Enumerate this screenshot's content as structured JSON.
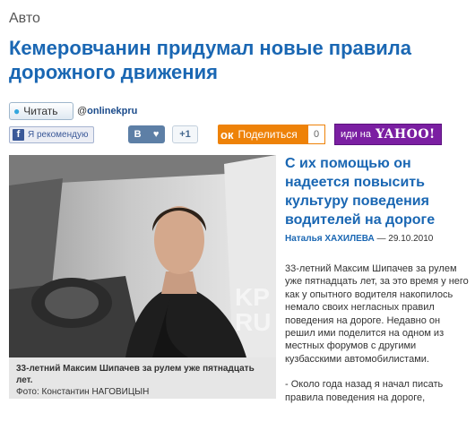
{
  "section": "Авто",
  "headline": "Кемеровчанин придумал новые правила дорожного движения",
  "social": {
    "twitter_label": "Читать",
    "handle_at": "@",
    "handle_name": "onlinekpru",
    "facebook_label": "Я рекомендую",
    "facebook_logo": "f",
    "vk_logo": "В",
    "vk_heart": "♥",
    "vk_count": "+1",
    "ok_logo": "ок",
    "ok_label": "Поделиться",
    "ok_count": "0",
    "yahoo_prefix": "иди на",
    "yahoo_word": "YAHOO!"
  },
  "photo": {
    "watermark": "KP RU",
    "caption": "33-летний Максим Шипачев за рулем уже пятнадцать лет.",
    "credit": "Фото: Константин НАГОВИЦЫН"
  },
  "article": {
    "subhead": "С их помощью он надеется повысить культуру поведения водителей на дороге",
    "author": "Наталья ХАХИЛЕВА",
    "date": " — 29.10.2010",
    "paragraph1": "33-летний Максим Шипачев за рулем уже пятнадцать лет, за это время у него как у опытного водителя накопилось немало своих негласных правил поведения на дороге. Недавно он решил ими поделится на одном из местных форумов с другими кузбасскими автомобилистами.",
    "paragraph2": "- Около года назад я начал писать правила поведения на дороге,"
  },
  "colors": {
    "headline": "#1a67b3",
    "ok_orange": "#ee8208",
    "yahoo_purple": "#7b1fa2",
    "vk_blue": "#5d7fa6",
    "fb_blue": "#3b5998"
  }
}
